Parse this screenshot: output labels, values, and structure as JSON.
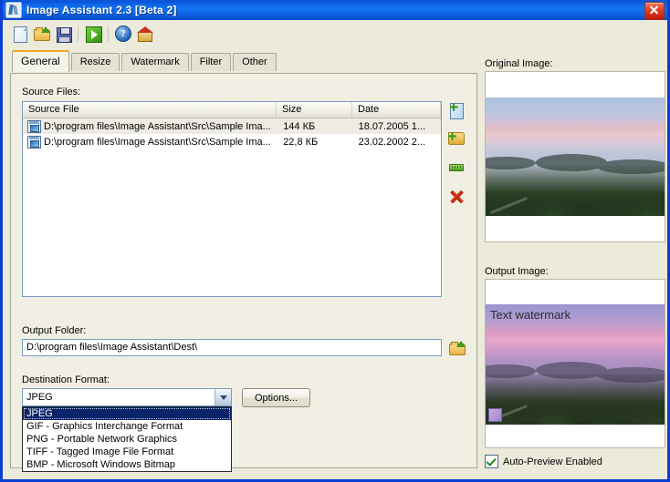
{
  "window": {
    "title": "Image Assistant 2.3 [Beta 2]",
    "app_icon": "app-icon",
    "close_label": "✕"
  },
  "toolbar": {
    "buttons": [
      {
        "name": "new-button",
        "icon": "new-document-icon",
        "tooltip": "New"
      },
      {
        "name": "open-button",
        "icon": "open-folder-icon",
        "tooltip": "Open"
      },
      {
        "name": "save-button",
        "icon": "save-floppy-icon",
        "tooltip": "Save"
      },
      {
        "name": "run-button",
        "icon": "run-play-icon",
        "tooltip": "Run"
      },
      {
        "name": "help-button",
        "icon": "help-question-icon",
        "tooltip": "Help"
      },
      {
        "name": "home-button",
        "icon": "home-icon",
        "tooltip": "Home"
      }
    ],
    "help_glyph": "?"
  },
  "tabs": [
    {
      "label": "General",
      "active": true
    },
    {
      "label": "Resize",
      "active": false
    },
    {
      "label": "Watermark",
      "active": false
    },
    {
      "label": "Filter",
      "active": false
    },
    {
      "label": "Other",
      "active": false
    }
  ],
  "source_files": {
    "label": "Source Files:",
    "columns": [
      "Source File",
      "Size",
      "Date"
    ],
    "rows": [
      {
        "file": "D:\\program files\\Image Assistant\\Src\\Sample Ima...",
        "size": "144 КБ",
        "date": "18.07.2005 1...",
        "selected": true
      },
      {
        "file": "D:\\program files\\Image Assistant\\Src\\Sample Ima...",
        "size": "22,8 КБ",
        "date": "23.02.2002 2...",
        "selected": false
      }
    ],
    "side_buttons": [
      {
        "name": "add-file-button",
        "icon": "add-file-icon"
      },
      {
        "name": "add-folder-button",
        "icon": "add-folder-icon"
      },
      {
        "name": "properties-button",
        "icon": "green-bar-icon"
      },
      {
        "name": "remove-button",
        "icon": "red-x-icon"
      }
    ]
  },
  "output_folder": {
    "label": "Output Folder:",
    "value": "D:\\program files\\Image Assistant\\Dest\\",
    "placeholder": "",
    "browse_icon": "browse-folder-icon"
  },
  "destination_format": {
    "label": "Destination Format:",
    "selected": "JPEG",
    "options": [
      "JPEG",
      "GIF - Graphics Interchange Format",
      "PNG - Portable Network Graphics",
      "TIFF - Tagged Image File Format",
      "BMP - Microsoft Windows Bitmap"
    ],
    "options_button": "Options..."
  },
  "preview": {
    "original_label": "Original Image:",
    "output_label": "Output Image:",
    "watermark_text": "Text watermark",
    "auto_preview_label": "Auto-Preview Enabled",
    "auto_preview_checked": true
  },
  "colors": {
    "title_bar": "#0E64E8",
    "window_face": "#ECEADB",
    "panel_face": "#F1EFE3",
    "tab_active_accent": "#F5A623",
    "selection": "#0A246A",
    "close_button": "#C11B08",
    "check_green": "#1E8A20"
  }
}
